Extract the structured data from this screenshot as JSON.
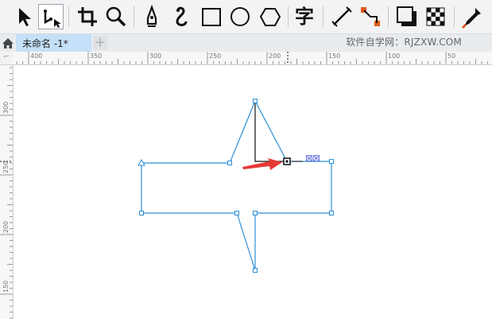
{
  "toolbar": {
    "tools": [
      "pick-tool",
      "shape-tool",
      "crop-tool",
      "zoom-tool",
      "freehand-tool",
      "artistic-media-tool",
      "rectangle-tool",
      "ellipse-tool",
      "polygon-tool",
      "text-tool",
      "parallel-dimension-tool",
      "connector-tool",
      "drop-shadow-tool",
      "transparency-tool",
      "color-eyedropper-tool"
    ],
    "active_tool": "shape-tool",
    "text_tool_glyph": "字"
  },
  "tabs": {
    "document_title": "未命名 -1*",
    "new_tab_symbol": "+"
  },
  "watermark": "软件自学网：RJZXW.COM",
  "ruler": {
    "corner_symbol": "⌐",
    "horizontal_labels": [
      "400",
      "350",
      "300",
      "250",
      "200",
      "150",
      "100",
      "50"
    ],
    "vertical_labels": [
      "300",
      "250",
      "200",
      "150"
    ]
  },
  "canvas": {
    "node_buttons": "⊠⊠",
    "colors": {
      "outline": "#2b8fd6",
      "arrow": "#e53935",
      "node_button": "#5a6ad8"
    }
  }
}
